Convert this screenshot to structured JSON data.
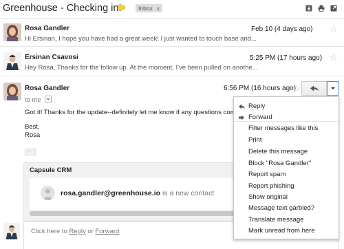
{
  "thread": {
    "subject": "Greenhouse - Checking in!",
    "label_chip": "Inbox",
    "label_chip_close": "x",
    "label_color": "#f6cf3c"
  },
  "header_icons": [
    "download-icon",
    "print-icon",
    "open-new-window-icon"
  ],
  "messages": [
    {
      "sender": "Rosa Gandler",
      "snippet": "Hi Ersinan, I hope you have had a great week! I just wanted to touch base and...",
      "date": "Feb 10 (4 days ago)"
    },
    {
      "sender": "Ersinan Csavosi",
      "snippet": "Hey Rosa, Thanks for the follow up. At the moment, I've been pulled on anothe...",
      "date": "5:25 PM (17 hours ago)"
    }
  ],
  "open_message": {
    "sender": "Rosa Gandler",
    "to": "to me",
    "date": "6:56 PM (16 hours ago)",
    "body_line1": "Got it! Thanks for the update--definitely let me know if any questions come",
    "body_line2": "Best,",
    "body_line3": "Rosa",
    "trimmed_content": "···"
  },
  "capsule_card": {
    "title": "Capsule CRM",
    "contact_email": "rosa.gandler@greenhouse.io",
    "contact_status": " is a new contact"
  },
  "reply_area": {
    "prefix": "Click here to ",
    "reply_link": "Reply",
    "middle": " or ",
    "forward_link": "Forward"
  },
  "dropdown_menu": {
    "items": [
      {
        "label": "Reply",
        "icon": "reply-icon"
      },
      {
        "label": "Forward",
        "icon": "forward-icon"
      },
      {
        "label": "Filter messages like this"
      },
      {
        "label": "Print"
      },
      {
        "label": "Delete this message"
      },
      {
        "label": "Block \"Rosa Gandler\""
      },
      {
        "label": "Report spam"
      },
      {
        "label": "Report phishing"
      },
      {
        "label": "Show original"
      },
      {
        "label": "Message text garbled?"
      },
      {
        "label": "Translate message"
      },
      {
        "label": "Mark unread from here"
      }
    ]
  },
  "colors": {
    "accent_blue": "#4a8af4",
    "divider": "#e5e5e5",
    "chip_bg": "#dddddd"
  }
}
